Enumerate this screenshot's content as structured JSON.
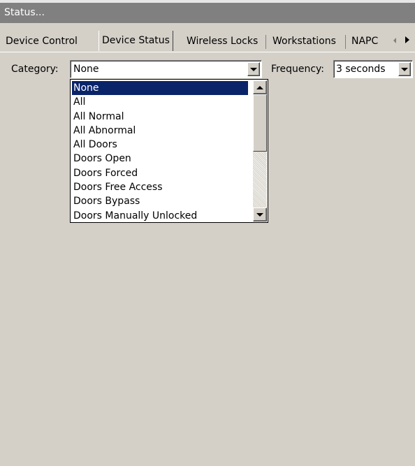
{
  "window": {
    "title": "Status..."
  },
  "tabs": [
    {
      "label": "Device Control",
      "active": false
    },
    {
      "label": "Device Status",
      "active": true
    },
    {
      "label": "Wireless Locks",
      "active": false
    },
    {
      "label": "Workstations",
      "active": false
    },
    {
      "label": "NAPC",
      "active": false
    }
  ],
  "filters": {
    "category_label": "Category:",
    "category_value": "None",
    "frequency_label": "Frequency:",
    "frequency_value": "3 seconds"
  },
  "category_options": [
    "None",
    "All",
    "All Normal",
    "All Abnormal",
    "All Doors",
    "Doors Open",
    "Doors Forced",
    "Doors Free Access",
    "Doors Bypass",
    "Doors Manually Unlocked"
  ],
  "colors": {
    "titlebar": "#808080",
    "window_background": "#d4d0c8",
    "selection": "#0a246a"
  }
}
